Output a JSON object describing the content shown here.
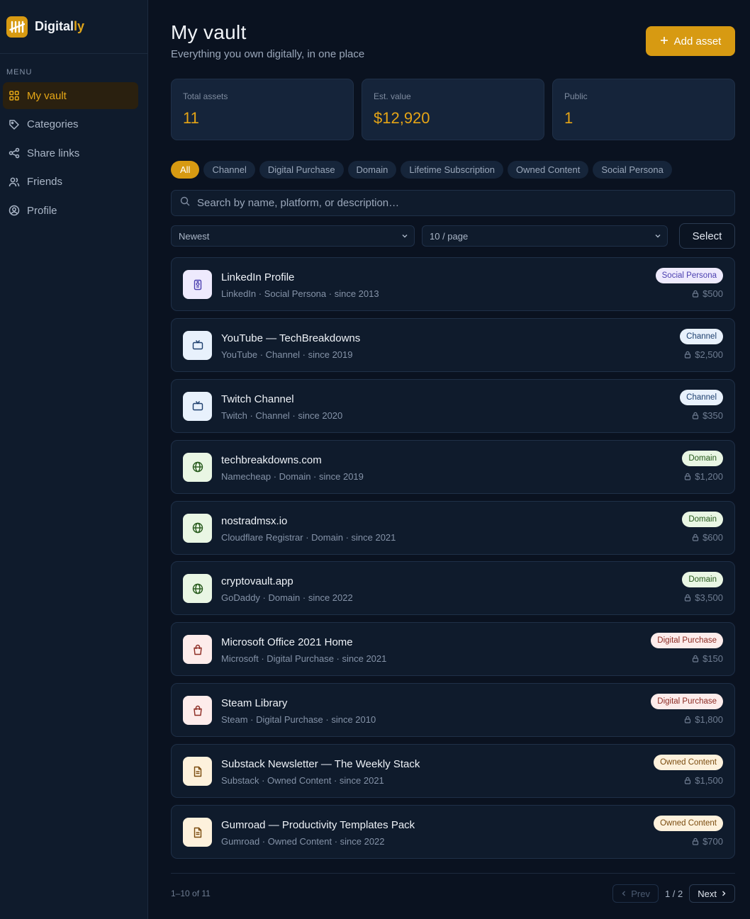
{
  "brand": {
    "name_main": "Digital",
    "name_accent": "ly"
  },
  "sidebar": {
    "menu_label": "MENU",
    "items": [
      {
        "label": "My vault",
        "icon": "grid-icon",
        "active": true
      },
      {
        "label": "Categories",
        "icon": "tag-icon",
        "active": false
      },
      {
        "label": "Share links",
        "icon": "share-icon",
        "active": false
      },
      {
        "label": "Friends",
        "icon": "users-icon",
        "active": false
      },
      {
        "label": "Profile",
        "icon": "user-circle-icon",
        "active": false
      }
    ]
  },
  "header": {
    "title": "My vault",
    "subtitle": "Everything you own digitally, in one place",
    "add_label": "Add asset"
  },
  "stats": [
    {
      "label": "Total assets",
      "value": "11"
    },
    {
      "label": "Est. value",
      "value": "$12,920"
    },
    {
      "label": "Public",
      "value": "1"
    }
  ],
  "filters": [
    "All",
    "Channel",
    "Digital Purchase",
    "Domain",
    "Lifetime Subscription",
    "Owned Content",
    "Social Persona"
  ],
  "search": {
    "placeholder": "Search by name, platform, or description…"
  },
  "sort": {
    "selected": "Newest"
  },
  "page_size": {
    "selected": "10 / page"
  },
  "select_label": "Select",
  "assets": [
    {
      "title": "LinkedIn Profile",
      "meta": "LinkedIn · Social Persona · since 2013",
      "badge": "Social Persona",
      "value": "$500",
      "kind": "persona"
    },
    {
      "title": "YouTube — TechBreakdowns",
      "meta": "YouTube · Channel · since 2019",
      "badge": "Channel",
      "value": "$2,500",
      "kind": "channel"
    },
    {
      "title": "Twitch Channel",
      "meta": "Twitch · Channel · since 2020",
      "badge": "Channel",
      "value": "$350",
      "kind": "channel"
    },
    {
      "title": "techbreakdowns.com",
      "meta": "Namecheap · Domain · since 2019",
      "badge": "Domain",
      "value": "$1,200",
      "kind": "domain"
    },
    {
      "title": "nostradmsx.io",
      "meta": "Cloudflare Registrar · Domain · since 2021",
      "badge": "Domain",
      "value": "$600",
      "kind": "domain"
    },
    {
      "title": "cryptovault.app",
      "meta": "GoDaddy · Domain · since 2022",
      "badge": "Domain",
      "value": "$3,500",
      "kind": "domain"
    },
    {
      "title": "Microsoft Office 2021 Home",
      "meta": "Microsoft · Digital Purchase · since 2021",
      "badge": "Digital Purchase",
      "value": "$150",
      "kind": "purchase"
    },
    {
      "title": "Steam Library",
      "meta": "Steam · Digital Purchase · since 2010",
      "badge": "Digital Purchase",
      "value": "$1,800",
      "kind": "purchase"
    },
    {
      "title": "Substack Newsletter — The Weekly Stack",
      "meta": "Substack · Owned Content · since 2021",
      "badge": "Owned Content",
      "value": "$1,500",
      "kind": "content"
    },
    {
      "title": "Gumroad — Productivity Templates Pack",
      "meta": "Gumroad · Owned Content · since 2022",
      "badge": "Owned Content",
      "value": "$700",
      "kind": "content"
    }
  ],
  "kind_styles": {
    "persona": {
      "icon": "id-badge-icon",
      "icon_bg": "#eeeafd",
      "icon_fg": "#4b3fb0",
      "badge_bg": "#eeeafd",
      "badge_fg": "#4b3fb0"
    },
    "channel": {
      "icon": "tv-icon",
      "icon_bg": "#e8f1fc",
      "icon_fg": "#1d3f6e",
      "badge_bg": "#e8f1fc",
      "badge_fg": "#1d3f6e"
    },
    "domain": {
      "icon": "globe-icon",
      "icon_bg": "#e9f6e4",
      "icon_fg": "#24581a",
      "badge_bg": "#e9f6e4",
      "badge_fg": "#24581a"
    },
    "purchase": {
      "icon": "shopping-bag-icon",
      "icon_bg": "#fdeceb",
      "icon_fg": "#8c2a22",
      "badge_bg": "#fdeceb",
      "badge_fg": "#8c2a22"
    },
    "content": {
      "icon": "document-icon",
      "icon_bg": "#fdf1dc",
      "icon_fg": "#7a4b0e",
      "badge_bg": "#fdf1dc",
      "badge_fg": "#7a4b0e"
    }
  },
  "pagination": {
    "range": "1–10 of 11",
    "prev": "Prev",
    "next": "Next",
    "page": "1 / 2"
  },
  "colors": {
    "accent": "#d79a12",
    "background": "#0a1220",
    "sidebar": "#0f1b2c"
  }
}
